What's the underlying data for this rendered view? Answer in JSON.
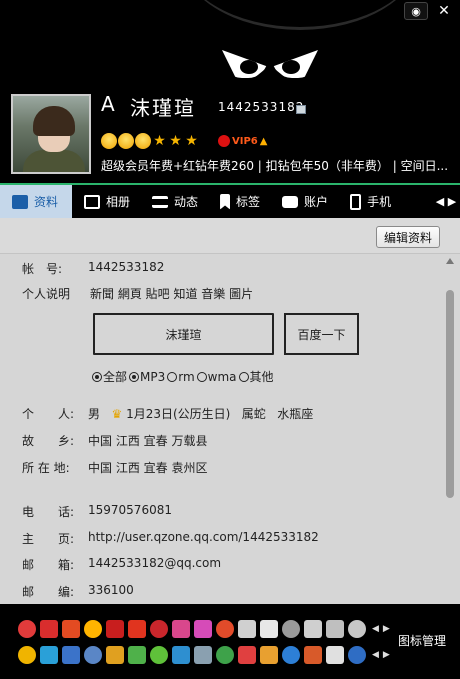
{
  "window": {
    "skin_icon": "skin-icon",
    "close_label": "✕"
  },
  "profile": {
    "letter": "A",
    "nickname": "沫瑾瑄",
    "qq_number": "1442533182",
    "vip_label": "VIP6",
    "services": "超级会员年费+红钻年费260 | 扣钻包年50（非年费） | 空间日..."
  },
  "tabs": [
    {
      "label": "资料",
      "icon": "profile-card-icon",
      "active": true
    },
    {
      "label": "相册",
      "icon": "photo-album-icon",
      "active": false
    },
    {
      "label": "动态",
      "icon": "feed-icon",
      "active": false
    },
    {
      "label": "标签",
      "icon": "bookmark-icon",
      "active": false
    },
    {
      "label": "账户",
      "icon": "wallet-icon",
      "active": false
    },
    {
      "label": "手机",
      "icon": "phone-icon",
      "active": false
    }
  ],
  "toolbar": {
    "edit_label": "编辑资料"
  },
  "details": {
    "account_label": "帐　号:",
    "account_value": "1442533182",
    "desc_label": "个人说明",
    "desc_value": "新聞 網頁 貼吧 知道 音樂 圖片",
    "search_value": "沫瑾瑄",
    "search_button": "百度一下",
    "radio_options": [
      {
        "label": "全部",
        "checked": true
      },
      {
        "label": "MP3",
        "checked": true
      },
      {
        "label": "rm",
        "checked": false
      },
      {
        "label": "wma",
        "checked": false
      },
      {
        "label": "其他",
        "checked": false
      }
    ],
    "person_label": "个　　人:",
    "gender": "男",
    "birthday": "1月23日(公历生日)",
    "zodiac": "属蛇",
    "sign": "水瓶座",
    "hometown_label": "故　　乡:",
    "hometown_value": "中国 江西 宜春 万载县",
    "location_label": "所 在 地:",
    "location_value": "中国 江西 宜春 袁州区",
    "phone_label": "电　　话:",
    "phone_value": "15970576081",
    "homepage_label": "主　　页:",
    "homepage_value": "http://user.qzone.qq.com/1442533182",
    "email_label": "邮　　箱:",
    "email_value": "1442533182@qq.com",
    "postcode_label": "邮　　编:",
    "postcode_value": "336100"
  },
  "iconbar": {
    "manage_label": "图标管理",
    "row1_colors": [
      "#e23b3b",
      "#d92d2d",
      "#e34b22",
      "#ffb400",
      "#c81e1e",
      "#e0341f",
      "#c9262c",
      "#d9478c",
      "#d64bb8",
      "#e24b2a",
      "#d0d0d0",
      "#e7e7e7",
      "#9a9a9a",
      "#cfcfcf",
      "#bfbfbf",
      "#c7c7c7"
    ],
    "row2_colors": [
      "#f0b400",
      "#2aa0d8",
      "#3b73c9",
      "#5a86c6",
      "#e0a020",
      "#4fb14a",
      "#5fc13a",
      "#2e8fd0",
      "#8aa0b0",
      "#3ea24a",
      "#e04040",
      "#e8a030",
      "#2d7fd6",
      "#d85a2a",
      "#e0e0e0",
      "#2f6dc4",
      "#3a80d8",
      "#d9d9d9"
    ]
  }
}
